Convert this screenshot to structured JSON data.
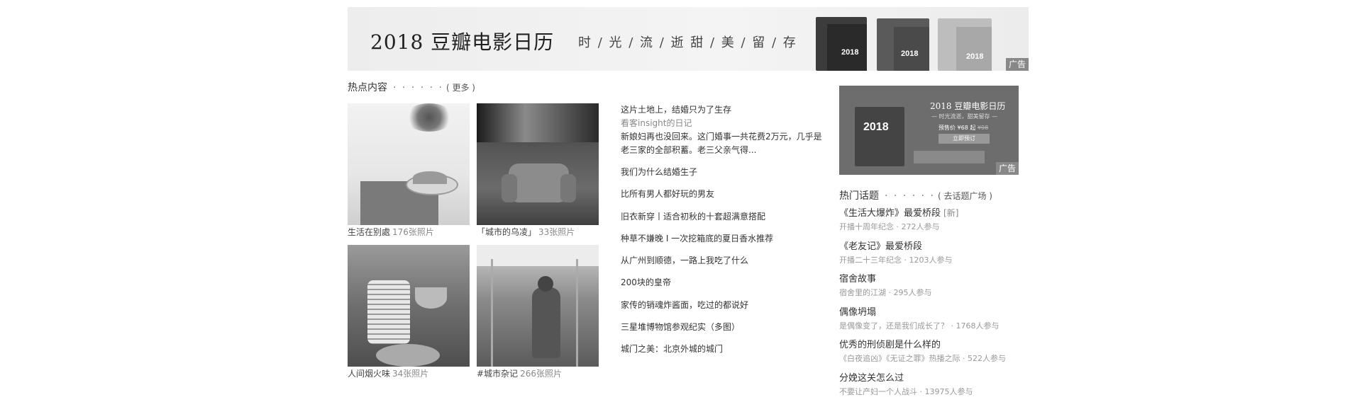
{
  "banner": {
    "title": "2018  豆瓣电影日历",
    "slogan": "时 / 光 / 流 / 逝     甜 / 美 / 留 / 存",
    "calendar_year": "2018",
    "ad_label": "广告"
  },
  "hot": {
    "heading": "热点内容",
    "dots": "· · · · · ·",
    "more_prefix": "( ",
    "more_label": "更多",
    "more_suffix": " )",
    "albums": [
      {
        "name": "生活在别處",
        "count": "176张照片"
      },
      {
        "name": "「城市的乌凌」",
        "count": "33张照片"
      },
      {
        "name": "人间烟火味",
        "count": "34张照片"
      },
      {
        "name": "#城市杂记",
        "count": "266张照片"
      }
    ],
    "featured": {
      "title": "这片土地上，结婚只为了生存",
      "author": "看客insight的日记",
      "abstract": "新娘妇再也没回来。这门婚事一共花费2万元，几乎是老三家的全部积蓄。老三父亲气得..."
    },
    "links": [
      "我们为什么结婚生子",
      "比所有男人都好玩的男友",
      "旧衣新穿丨适合初秋的十套超满意搭配",
      "种草不嫌晚 I 一次挖箱底的夏日香水推荐",
      "从广州到顺德，一路上我吃了什么",
      "200块的皇帝",
      "家传的销魂炸酱面，吃过的都说好",
      "三星堆博物馆参观纪实（多图）",
      "城门之美：北京外城的城门"
    ]
  },
  "side_ad": {
    "year": "2018",
    "title": "2018  豆瓣电影日历",
    "slogan": "— 时光流逝，甜美留存 —",
    "price": "预售价 ¥68 起",
    "old_price": "¥98",
    "button": "立即预订",
    "ad_label": "广告"
  },
  "topics": {
    "heading": "热门话题",
    "dots": "· · · · · ·",
    "more_prefix": "( ",
    "more_label": "去话题广场",
    "more_suffix": " )",
    "items": [
      {
        "title": "《生活大爆炸》最爱桥段",
        "badge": "[新]",
        "meta": "开播十周年纪念 · 272人参与"
      },
      {
        "title": "《老友记》最爱桥段",
        "badge": "",
        "meta": "开播二十三年纪念 · 1203人参与"
      },
      {
        "title": "宿舍故事",
        "badge": "",
        "meta": "宿舍里的江湖 · 295人参与"
      },
      {
        "title": "偶像坍塌",
        "badge": "",
        "meta": "是偶像变了，还是我们成长了？ · 1768人参与"
      },
      {
        "title": "优秀的刑侦剧是什么样的",
        "badge": "",
        "meta": "《白夜追凶》《无证之罪》热播之际 · 522人参与"
      },
      {
        "title": "分娩这关怎么过",
        "badge": "",
        "meta": "不要让产妇一个人战斗 · 13975人参与"
      }
    ]
  }
}
